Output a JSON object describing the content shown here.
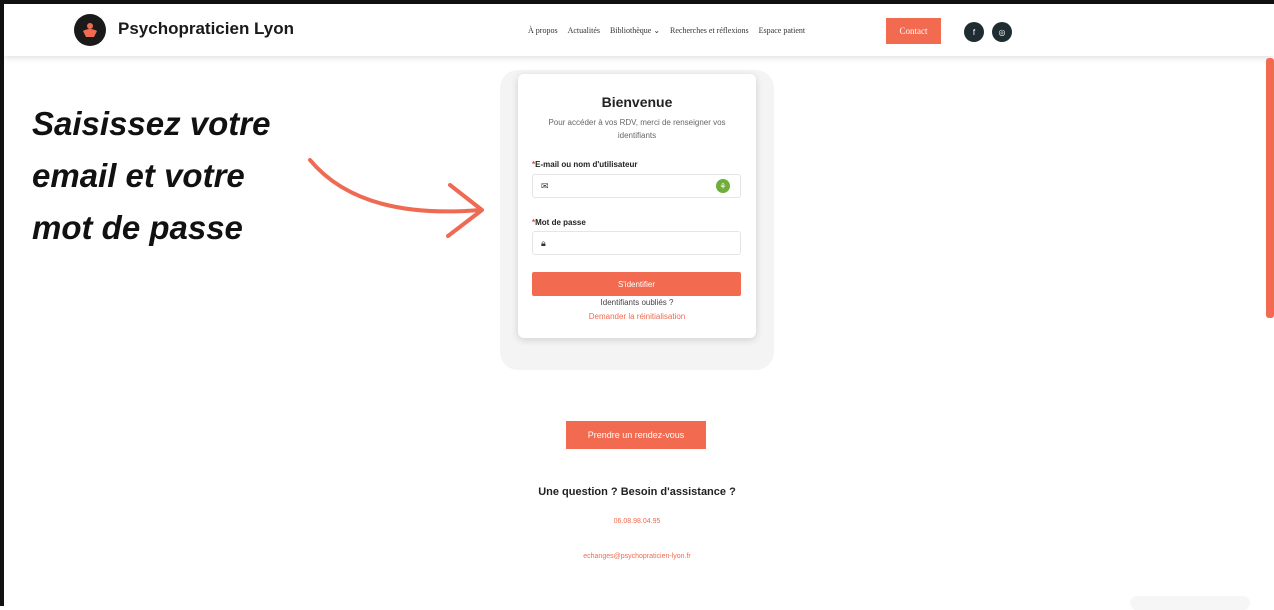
{
  "header": {
    "brand": "Psychopraticien Lyon",
    "nav": [
      "À propos",
      "Actualités",
      "Bibliothèque ⌄",
      "Recherches et réflexions",
      "Espace patient"
    ],
    "contact_label": "Contact",
    "social": [
      {
        "icon": "facebook-icon",
        "glyph": "f"
      },
      {
        "icon": "instagram-icon",
        "glyph": "◎"
      }
    ]
  },
  "annotation": {
    "lines": [
      "Saisissez votre",
      "email et votre",
      "mot de passe"
    ]
  },
  "login": {
    "title": "Bienvenue",
    "subtitle": "Pour accéder à vos RDV, merci de renseigner vos identifiants",
    "email_label": "E-mail ou nom d'utilisateur",
    "password_label": "Mot de passe",
    "required_mark": "*",
    "email_value": "",
    "password_value": "",
    "submit_label": "S'identifier",
    "forgot_text": "Identifiants oubliés ?",
    "reset_link": "Demander la réinitialisation"
  },
  "footer": {
    "rdv_label": "Prendre un rendez-vous",
    "question": "Une question ? Besoin d'assistance ?",
    "phone": "06.08.98.04.95",
    "email": "echanges@psychopraticien-lyon.fr"
  },
  "colors": {
    "accent": "#f26a4f",
    "dark": "#1f2d33"
  }
}
